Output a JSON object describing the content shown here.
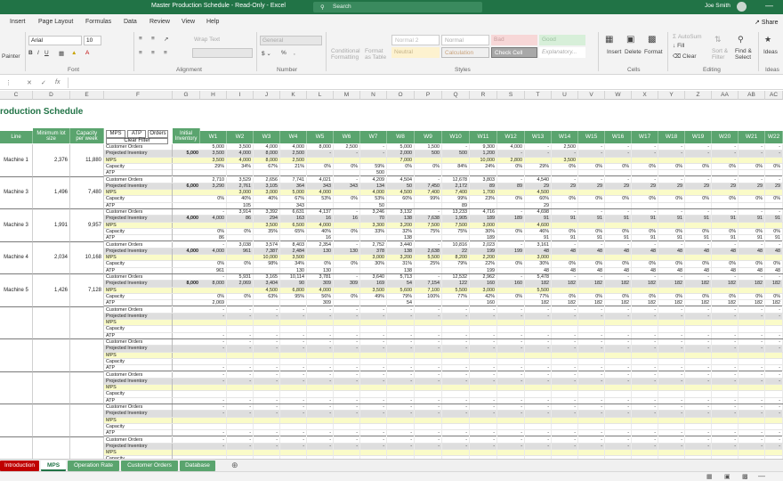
{
  "titlebar": {
    "title": "Master Production Schedule  -  Read-Only  -  Excel",
    "search_placeholder": "Search",
    "user": "Joe Smith",
    "accent": "#217346"
  },
  "menu": [
    "Insert",
    "Page Layout",
    "Formulas",
    "Data",
    "Review",
    "View",
    "Help"
  ],
  "share_label": "Share",
  "ribbon": {
    "painter": "Painter",
    "font_name": "Arial",
    "font_size": "10",
    "wrap_text": "Wrap Text",
    "number_format": "General",
    "cond_format": "Conditional Formatting",
    "format_table": "Format as Table",
    "styles": {
      "normal2": "Normal 2",
      "normal": "Normal",
      "bad": "Bad",
      "good": "Good",
      "neutral": "Neutral",
      "calculation": "Calculation",
      "check_cell": "Check Cell",
      "explanatory": "Explanatory..."
    },
    "insert": "Insert",
    "delete": "Delete",
    "format": "Format",
    "autosum": "AutoSum",
    "fill": "Fill",
    "clear": "Clear",
    "sort_filter": "Sort & Filter",
    "find_select": "Find & Select",
    "ideas": "Ideas",
    "groups": {
      "font": "Font",
      "alignment": "Alignment",
      "number": "Number",
      "styles": "Styles",
      "cells": "Cells",
      "editing": "Editing",
      "ideas": "Ideas"
    }
  },
  "columns": [
    "C",
    "D",
    "E",
    "F",
    "G",
    "H",
    "I",
    "J",
    "K",
    "L",
    "M",
    "N",
    "O",
    "P",
    "Q",
    "R",
    "S",
    "T",
    "U",
    "V",
    "W",
    "X",
    "Y",
    "Z",
    "AA",
    "AB",
    "AC"
  ],
  "sheet": {
    "title": "roduction Schedule",
    "headers": {
      "line": "Line",
      "min_lot": "Minimum lot size",
      "capacity": "Capacity per week",
      "initial_inventory": "Initial Inventory"
    },
    "buttons": {
      "mps": "MPS",
      "atp": "ATP",
      "orders": "Orders",
      "clear_filter": "Clear Filter"
    },
    "weeks": [
      "W1",
      "W2",
      "W3",
      "W4",
      "W5",
      "W6",
      "W7",
      "W8",
      "W9",
      "W10",
      "W11",
      "W12",
      "W13",
      "W14",
      "W15",
      "W16",
      "W17",
      "W18",
      "W19",
      "W20",
      "W21",
      "W22"
    ],
    "row_types": [
      "Customer Orders",
      "Projected Inventory",
      "MPS",
      "Capacity",
      "ATP"
    ],
    "machines": [
      {
        "name": "Machine 1",
        "min_lot": "2,376",
        "capacity": "11,880",
        "initial_inventory": "5,000",
        "rows": [
          [
            "5,000",
            "3,500",
            "4,000",
            "4,000",
            "8,000",
            "2,500",
            "-",
            "5,000",
            "1,500",
            "-",
            "9,300",
            "4,000",
            "-",
            "2,500",
            "-",
            "-",
            "-",
            "-",
            "-",
            "-",
            "-",
            "-"
          ],
          [
            "3,500",
            "4,000",
            "8,000",
            "2,500",
            "-",
            "-",
            "-",
            "2,000",
            "500",
            "500",
            "1,200",
            "-",
            "-",
            "-",
            "-",
            "-",
            "-",
            "-",
            "-",
            "-",
            "-",
            "-"
          ],
          [
            "3,500",
            "4,000",
            "8,000",
            "2,500",
            "",
            "",
            "",
            "7,000",
            "",
            "",
            "10,000",
            "2,800",
            "",
            "3,500",
            "",
            "",
            "",
            "",
            "",
            "",
            "",
            ""
          ],
          [
            "29%",
            "34%",
            "67%",
            "21%",
            "0%",
            "0%",
            "59%",
            "0%",
            "0%",
            "84%",
            "24%",
            "0%",
            "29%",
            "0%",
            "0%",
            "0%",
            "0%",
            "0%",
            "0%",
            "0%",
            "0%",
            "0%"
          ],
          [
            "",
            "",
            "",
            "",
            "",
            "",
            "500",
            "",
            "",
            "",
            "",
            "",
            "",
            "",
            "",
            "",
            "",
            "",
            "",
            "",
            "",
            ""
          ]
        ]
      },
      {
        "name": "Machine 3",
        "min_lot": "1,496",
        "capacity": "7,480",
        "initial_inventory": "6,000",
        "rows": [
          [
            "2,710",
            "3,529",
            "2,656",
            "7,741",
            "4,021",
            "-",
            "4,209",
            "4,504",
            "-",
            "12,678",
            "3,803",
            "-",
            "4,540",
            "-",
            "-",
            "-",
            "-",
            "-",
            "-",
            "-",
            "-",
            "-"
          ],
          [
            "3,290",
            "2,761",
            "3,105",
            "364",
            "343",
            "343",
            "134",
            "50",
            "7,450",
            "2,172",
            "89",
            "89",
            "29",
            "29",
            "29",
            "29",
            "29",
            "29",
            "29",
            "29",
            "29",
            "29"
          ],
          [
            "",
            "3,000",
            "3,000",
            "5,000",
            "4,000",
            "",
            "4,000",
            "4,500",
            "7,400",
            "7,400",
            "1,700",
            "",
            "4,500",
            "",
            "",
            "",
            "",
            "",
            "",
            "",
            "",
            ""
          ],
          [
            "0%",
            "40%",
            "40%",
            "67%",
            "53%",
            "0%",
            "53%",
            "60%",
            "99%",
            "99%",
            "23%",
            "0%",
            "60%",
            "0%",
            "0%",
            "0%",
            "0%",
            "0%",
            "0%",
            "0%",
            "0%",
            "0%"
          ],
          [
            "",
            "105",
            "",
            "343",
            "",
            "",
            "50",
            "",
            "",
            "89",
            "",
            "",
            "29",
            "",
            "",
            "",
            "",
            "",
            "",
            "",
            "",
            ""
          ]
        ]
      },
      {
        "name": "Machine 3",
        "min_lot": "1,991",
        "capacity": "9,957",
        "initial_inventory": "4,000",
        "rows": [
          [
            "-",
            "3,914",
            "3,392",
            "6,631",
            "4,137",
            "-",
            "3,246",
            "3,132",
            "-",
            "13,233",
            "4,716",
            "-",
            "4,698",
            "-",
            "-",
            "-",
            "-",
            "-",
            "-",
            "-",
            "-",
            "-"
          ],
          [
            "4,000",
            "86",
            "294",
            "163",
            "16",
            "16",
            "70",
            "138",
            "7,638",
            "1,905",
            "189",
            "189",
            "91",
            "91",
            "91",
            "91",
            "91",
            "91",
            "91",
            "91",
            "91",
            "91"
          ],
          [
            "",
            "",
            "3,500",
            "6,500",
            "4,000",
            "",
            "3,300",
            "3,200",
            "7,500",
            "7,500",
            "3,000",
            "",
            "4,600",
            "",
            "",
            "",
            "",
            "",
            "",
            "",
            "",
            ""
          ],
          [
            "0%",
            "0%",
            "35%",
            "65%",
            "40%",
            "0%",
            "33%",
            "32%",
            "75%",
            "75%",
            "30%",
            "0%",
            "46%",
            "0%",
            "0%",
            "0%",
            "0%",
            "0%",
            "0%",
            "0%",
            "0%",
            "0%"
          ],
          [
            "86",
            "",
            "",
            "",
            "16",
            "",
            "",
            "138",
            "",
            "",
            "189",
            "",
            "91",
            "91",
            "91",
            "91",
            "91",
            "91",
            "91",
            "91",
            "91",
            "91"
          ]
        ]
      },
      {
        "name": "Machine 4",
        "min_lot": "2,034",
        "capacity": "10,168",
        "initial_inventory": "4,000",
        "rows": [
          [
            "-",
            "3,038",
            "3,574",
            "8,403",
            "2,354",
            "-",
            "2,752",
            "3,440",
            "-",
            "10,816",
            "2,023",
            "-",
            "3,161",
            "-",
            "-",
            "-",
            "-",
            "-",
            "-",
            "-",
            "-",
            "-"
          ],
          [
            "4,000",
            "961",
            "7,387",
            "2,484",
            "130",
            "130",
            "378",
            "138",
            "2,638",
            "22",
            "199",
            "199",
            "48",
            "48",
            "48",
            "48",
            "48",
            "48",
            "48",
            "48",
            "48",
            "48"
          ],
          [
            "",
            "",
            "10,000",
            "3,500",
            "",
            "",
            "3,000",
            "3,200",
            "5,500",
            "8,200",
            "2,200",
            "",
            "3,000",
            "",
            "",
            "",
            "",
            "",
            "",
            "",
            "",
            ""
          ],
          [
            "0%",
            "0%",
            "98%",
            "34%",
            "0%",
            "0%",
            "30%",
            "31%",
            "25%",
            "79%",
            "22%",
            "0%",
            "30%",
            "0%",
            "0%",
            "0%",
            "0%",
            "0%",
            "0%",
            "0%",
            "0%",
            "0%"
          ],
          [
            "961",
            "",
            "",
            "130",
            "130",
            "",
            "",
            "138",
            "",
            "",
            "199",
            "",
            "48",
            "48",
            "48",
            "48",
            "48",
            "48",
            "48",
            "48",
            "48",
            "48"
          ]
        ]
      },
      {
        "name": "Machine 5",
        "min_lot": "1,426",
        "capacity": "7,128",
        "initial_inventory": "8,000",
        "rows": [
          [
            "-",
            "5,931",
            "3,165",
            "10,114",
            "3,781",
            "-",
            "3,640",
            "5,713",
            "-",
            "12,532",
            "2,962",
            "-",
            "5,478",
            "-",
            "-",
            "-",
            "-",
            "-",
            "-",
            "-",
            "-",
            "-"
          ],
          [
            "8,000",
            "2,069",
            "3,404",
            "90",
            "309",
            "309",
            "169",
            "54",
            "7,154",
            "122",
            "160",
            "160",
            "182",
            "182",
            "182",
            "182",
            "182",
            "182",
            "182",
            "182",
            "182",
            "182"
          ],
          [
            "",
            "",
            "4,500",
            "6,800",
            "4,000",
            "",
            "3,500",
            "5,600",
            "7,100",
            "5,500",
            "3,000",
            "",
            "5,500",
            "",
            "",
            "",
            "",
            "",
            "",
            "",
            "",
            ""
          ],
          [
            "0%",
            "0%",
            "63%",
            "95%",
            "56%",
            "0%",
            "49%",
            "79%",
            "100%",
            "77%",
            "42%",
            "0%",
            "77%",
            "0%",
            "0%",
            "0%",
            "0%",
            "0%",
            "0%",
            "0%",
            "0%",
            "0%"
          ],
          [
            "2,069",
            "",
            "",
            "",
            "309",
            "",
            "",
            "54",
            "",
            "",
            "160",
            "",
            "182",
            "182",
            "182",
            "182",
            "182",
            "182",
            "182",
            "182",
            "182",
            "182"
          ]
        ]
      }
    ],
    "empty_blocks": 5
  },
  "tabs": [
    {
      "label": "Introduction",
      "color": "#c00000"
    },
    {
      "label": "MPS",
      "color": "#ffffff"
    },
    {
      "label": "Operation Rate",
      "color": "#5aa46e"
    },
    {
      "label": "Customer Orders",
      "color": "#5aa46e"
    },
    {
      "label": "Database",
      "color": "#5aa46e"
    }
  ]
}
